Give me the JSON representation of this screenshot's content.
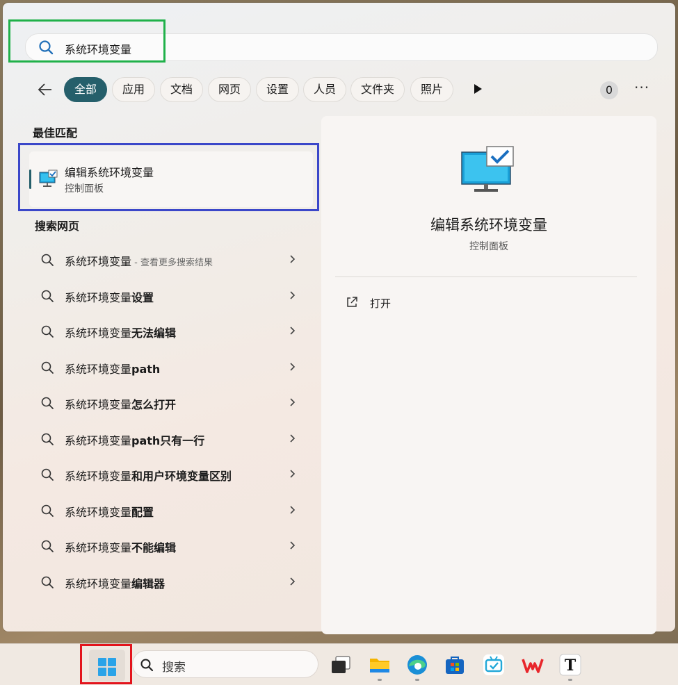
{
  "search": {
    "query": "系统环境变量"
  },
  "filters": {
    "tabs": [
      {
        "label": "全部",
        "active": true
      },
      {
        "label": "应用"
      },
      {
        "label": "文档"
      },
      {
        "label": "网页"
      },
      {
        "label": "设置"
      },
      {
        "label": "人员"
      },
      {
        "label": "文件夹"
      },
      {
        "label": "照片"
      }
    ],
    "count_badge": "0",
    "more_label": "···"
  },
  "best_match": {
    "heading": "最佳匹配",
    "item": {
      "name": "编辑系统环境变量",
      "subtitle": "控制面板"
    }
  },
  "web_search": {
    "heading": "搜索网页",
    "items": [
      {
        "prefix": "系统环境变量",
        "bold": "",
        "hint": " - 查看更多搜索结果"
      },
      {
        "prefix": "系统环境变量",
        "bold": "设置",
        "hint": ""
      },
      {
        "prefix": "系统环境变量",
        "bold": "无法编辑",
        "hint": ""
      },
      {
        "prefix": "系统环境变量",
        "bold": "path",
        "hint": ""
      },
      {
        "prefix": "系统环境变量",
        "bold": "怎么打开",
        "hint": ""
      },
      {
        "prefix": "系统环境变量",
        "bold": "path只有一行",
        "hint": ""
      },
      {
        "prefix": "系统环境变量",
        "bold": "和用户环境变量区别",
        "hint": ""
      },
      {
        "prefix": "系统环境变量",
        "bold": "配置",
        "hint": ""
      },
      {
        "prefix": "系统环境变量",
        "bold": "不能编辑",
        "hint": ""
      },
      {
        "prefix": "系统环境变量",
        "bold": "编辑器",
        "hint": ""
      }
    ]
  },
  "detail": {
    "title": "编辑系统环境变量",
    "subtitle": "控制面板",
    "actions": [
      {
        "label": "打开",
        "icon": "open-external-icon"
      }
    ]
  },
  "taskbar": {
    "search_label": "搜索",
    "apps": [
      {
        "name": "task-view",
        "icon": "task-view-icon"
      },
      {
        "name": "file-explorer",
        "icon": "folder-icon"
      },
      {
        "name": "edge",
        "icon": "edge-icon"
      },
      {
        "name": "store",
        "icon": "store-icon"
      },
      {
        "name": "bilibili",
        "icon": "tv-icon"
      },
      {
        "name": "wps",
        "icon": "wps-icon"
      },
      {
        "name": "typora",
        "icon": "typora-icon"
      }
    ],
    "typora_letter": "T"
  },
  "colors": {
    "accent": "#255f6b",
    "highlight_green": "#20b14a",
    "highlight_blue": "#3b47c9",
    "highlight_red": "#e3141c"
  }
}
